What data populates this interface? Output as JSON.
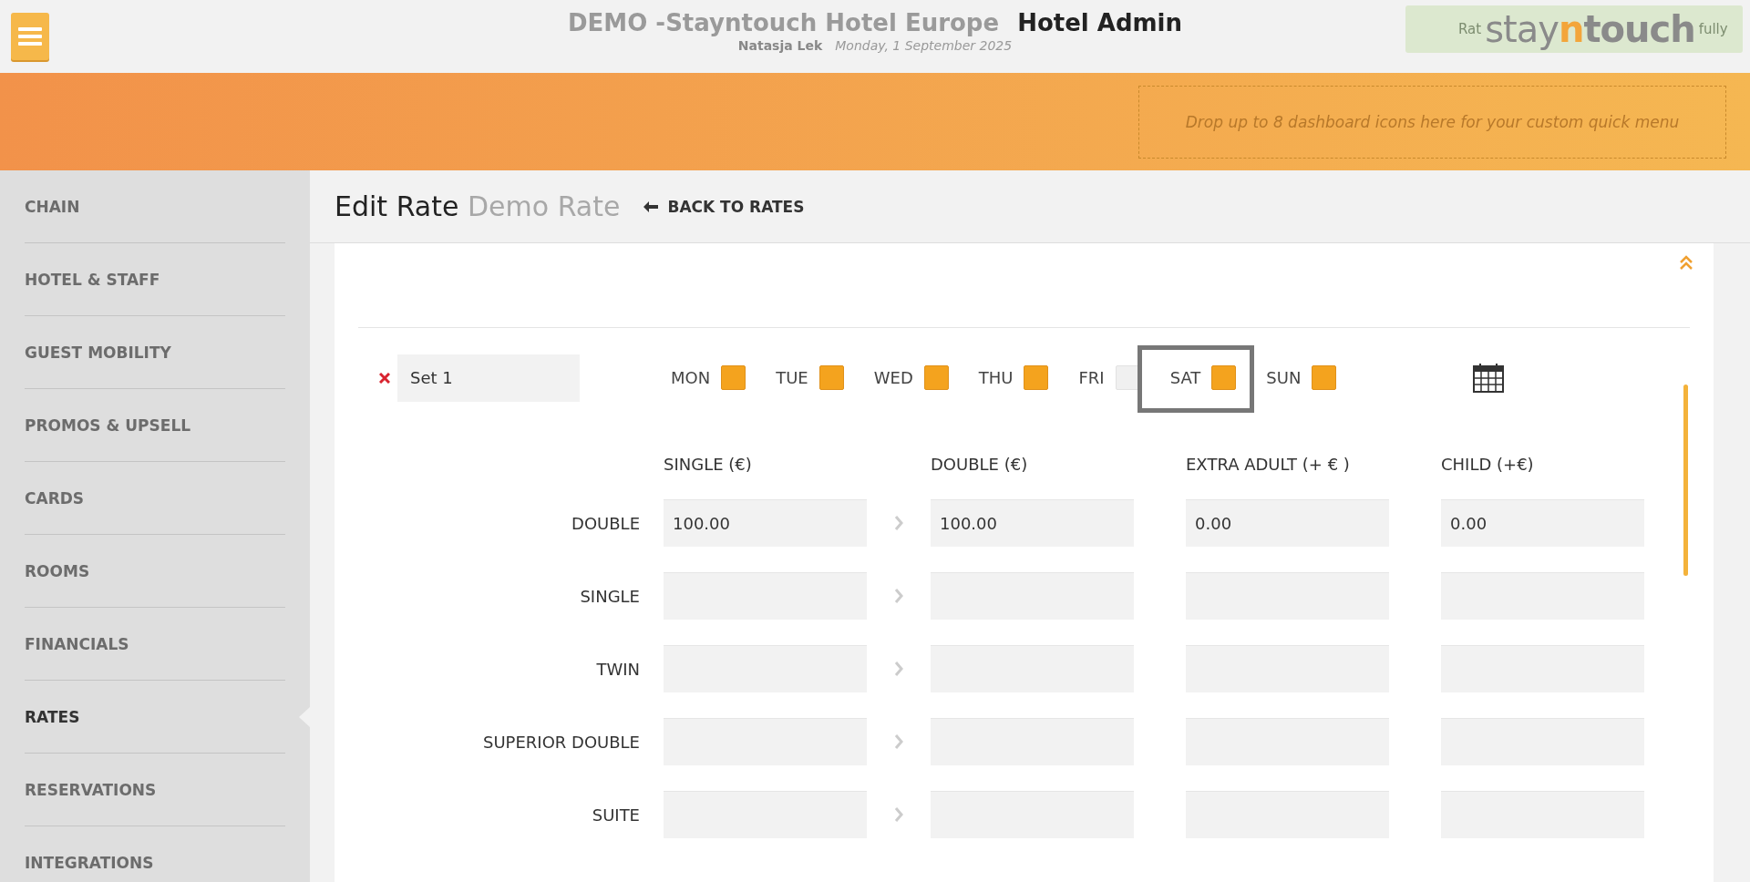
{
  "header": {
    "hotel": "DEMO -Stayntouch Hotel Europe",
    "app": "Hotel Admin",
    "user": "Natasja Lek",
    "date": "Monday, 1 September 2025",
    "toast_start": "Rat",
    "toast_end": "fully",
    "logo": {
      "start": "stay",
      "accent": "n",
      "end": "touch"
    }
  },
  "quick_menu": {
    "placeholder": "Drop up to 8 dashboard icons here for your custom quick menu"
  },
  "sidebar": {
    "items": [
      {
        "label": "CHAIN",
        "selected": false
      },
      {
        "label": "HOTEL & STAFF",
        "selected": false
      },
      {
        "label": "GUEST MOBILITY",
        "selected": false
      },
      {
        "label": "PROMOS & UPSELL",
        "selected": false
      },
      {
        "label": "CARDS",
        "selected": false
      },
      {
        "label": "ROOMS",
        "selected": false
      },
      {
        "label": "FINANCIALS",
        "selected": false
      },
      {
        "label": "RATES",
        "selected": true
      },
      {
        "label": "RESERVATIONS",
        "selected": false
      },
      {
        "label": "INTEGRATIONS",
        "selected": false
      }
    ]
  },
  "page": {
    "title": "Edit Rate",
    "subtitle": "Demo Rate",
    "back": "BACK TO RATES"
  },
  "set": {
    "name": "Set 1",
    "days": [
      {
        "label": "MON",
        "checked": true
      },
      {
        "label": "TUE",
        "checked": true
      },
      {
        "label": "WED",
        "checked": true
      },
      {
        "label": "THU",
        "checked": true
      },
      {
        "label": "FRI",
        "checked": false
      },
      {
        "label": "SAT",
        "checked": true
      },
      {
        "label": "SUN",
        "checked": true
      }
    ]
  },
  "table": {
    "columns": [
      "SINGLE (€)",
      "DOUBLE (€)",
      "EXTRA ADULT (+ € )",
      "CHILD (+€)"
    ],
    "rows": [
      {
        "room": "DOUBLE",
        "values": [
          "100.00",
          "100.00",
          "0.00",
          "0.00"
        ]
      },
      {
        "room": "SINGLE"
      },
      {
        "room": "TWIN"
      },
      {
        "room": "SUPERIOR DOUBLE"
      },
      {
        "room": "SUITE"
      }
    ]
  }
}
